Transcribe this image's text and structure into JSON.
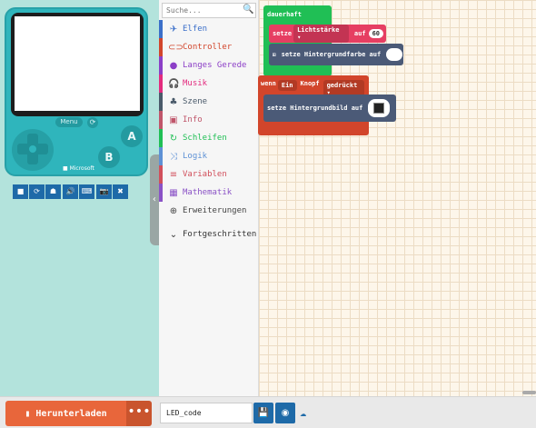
{
  "simulator": {
    "menu_label": "Menu",
    "a_label": "A",
    "b_label": "B",
    "brand": "■ Microsoft",
    "reset_icon": "⟳",
    "tools": [
      "■",
      "⟳",
      "☗",
      "🔊",
      "⌨",
      "📷",
      "✖"
    ],
    "collapse_icon": "‹"
  },
  "toolbox": {
    "search_placeholder": "Suche...",
    "search_icon": "🔍",
    "categories": [
      {
        "label": "Elfen",
        "icon": "✈",
        "color": "#3b6fc9"
      },
      {
        "label": "Controller",
        "icon": "⊂⊃",
        "color": "#d2452b"
      },
      {
        "label": "Langes Gerede",
        "icon": "●",
        "color": "#8c3fc7"
      },
      {
        "label": "Musik",
        "icon": "🎧",
        "color": "#e32b7e"
      },
      {
        "label": "Szene",
        "icon": "♣",
        "color": "#4a5a6a"
      },
      {
        "label": "Info",
        "icon": "▣",
        "color": "#c0566b"
      },
      {
        "label": "Schleifen",
        "icon": "↻",
        "color": "#20bf55"
      },
      {
        "label": "Logik",
        "icon": "⤨",
        "color": "#5e91d5"
      },
      {
        "label": "Variablen",
        "icon": "≡",
        "color": "#d14f5b"
      },
      {
        "label": "Mathematik",
        "icon": "▦",
        "color": "#8a52c6"
      },
      {
        "label": "Erweiterungen",
        "icon": "⊕",
        "color": "#444444"
      },
      {
        "label": "Fortgeschritten",
        "icon": "⌄",
        "color": "#333333"
      }
    ]
  },
  "workspace": {
    "forever_label": "dauerhaft",
    "set_label": "setze",
    "brightness_label": "Lichtstärke ▾",
    "to_label": "auf",
    "brightness_value": "60",
    "set_bg_color_label": "setze Hintergrundfarbe auf",
    "when_label": "wenn",
    "button_label": "Ein",
    "knopf_label": "Knopf",
    "pressed_label": "gedrückt ▾",
    "set_bg_image_label": "setze Hintergrundbild auf"
  },
  "bottom": {
    "download_label": "Herunterladen",
    "download_icon": "▮",
    "more_label": "•••",
    "project_name": "LED_code",
    "save_icon": "💾",
    "github_icon": "◉",
    "cloud_icon": "☁"
  }
}
